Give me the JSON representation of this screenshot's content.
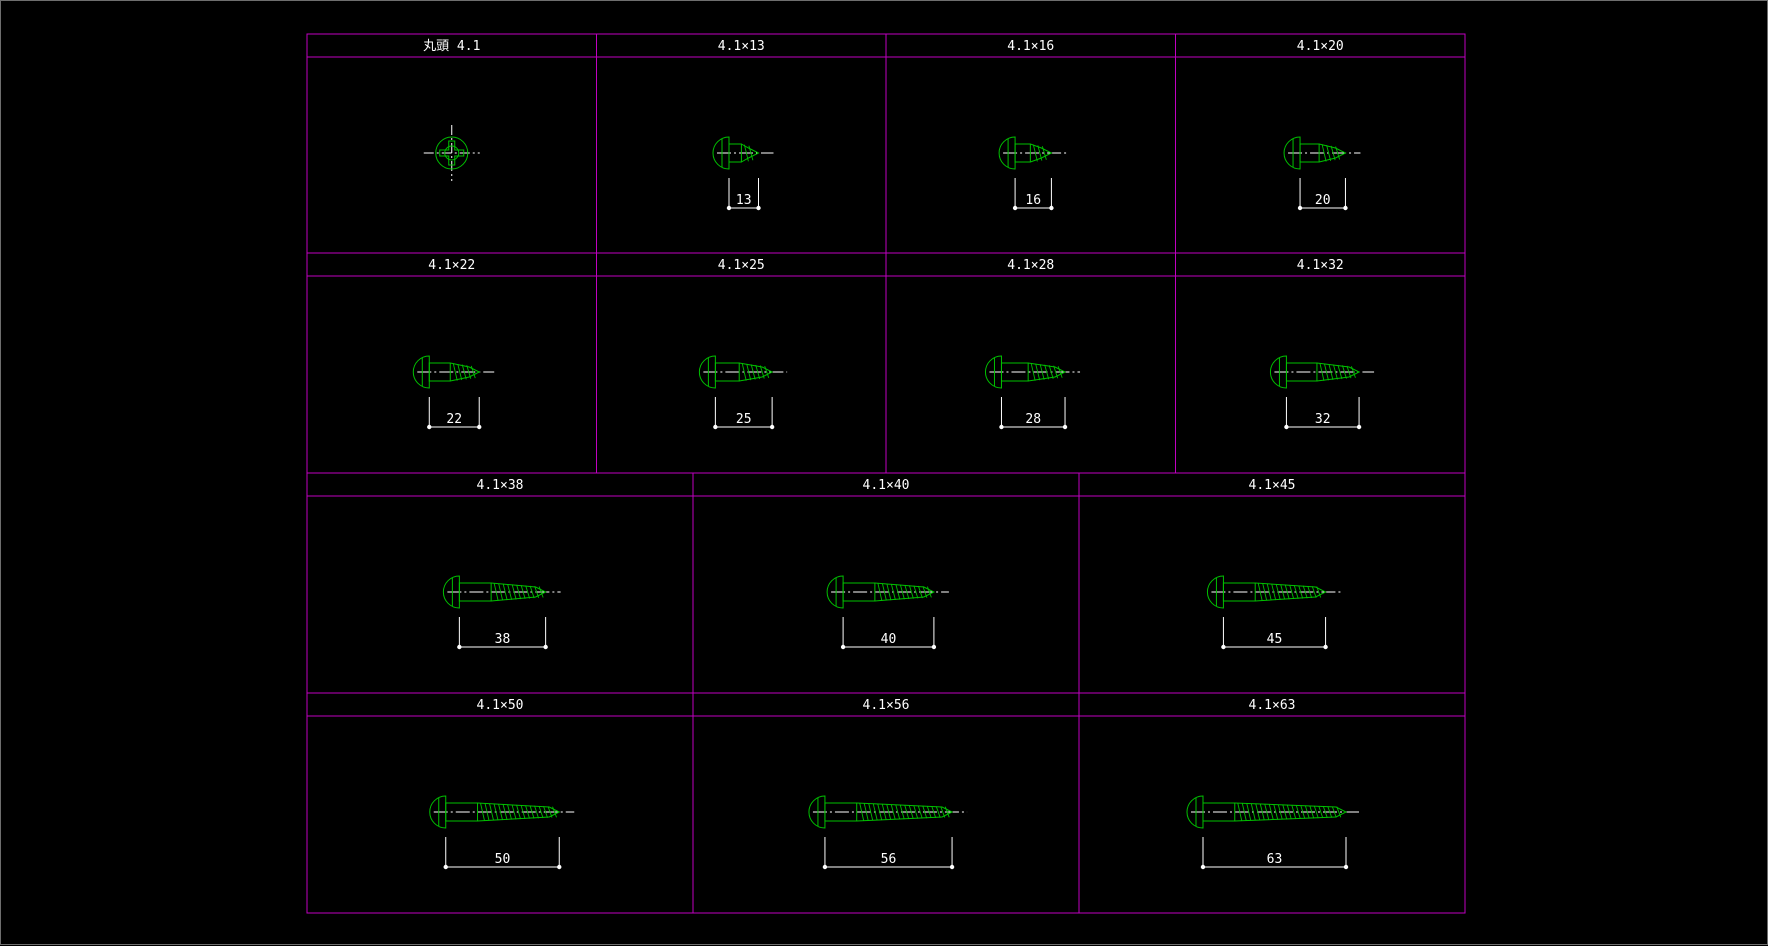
{
  "colors": {
    "background": "#000000",
    "frame": "#c000c0",
    "screw": "#00c000",
    "centerline": "#ffffff",
    "dimension": "#ffffff",
    "text": "#ffffff"
  },
  "rows": [
    {
      "cells": [
        {
          "title": "丸頭 4.1",
          "view": "top"
        },
        {
          "title": "4.1×13",
          "length": 13,
          "dim_label": "13"
        },
        {
          "title": "4.1×16",
          "length": 16,
          "dim_label": "16"
        },
        {
          "title": "4.1×20",
          "length": 20,
          "dim_label": "20"
        }
      ]
    },
    {
      "cells": [
        {
          "title": "4.1×22",
          "length": 22,
          "dim_label": "22"
        },
        {
          "title": "4.1×25",
          "length": 25,
          "dim_label": "25"
        },
        {
          "title": "4.1×28",
          "length": 28,
          "dim_label": "28"
        },
        {
          "title": "4.1×32",
          "length": 32,
          "dim_label": "32"
        }
      ]
    },
    {
      "cells": [
        {
          "title": "4.1×38",
          "length": 38,
          "dim_label": "38"
        },
        {
          "title": "4.1×40",
          "length": 40,
          "dim_label": "40"
        },
        {
          "title": "4.1×45",
          "length": 45,
          "dim_label": "45"
        }
      ]
    },
    {
      "cells": [
        {
          "title": "4.1×50",
          "length": 50,
          "dim_label": "50"
        },
        {
          "title": "4.1×56",
          "length": 56,
          "dim_label": "56"
        },
        {
          "title": "4.1×63",
          "length": 63,
          "dim_label": "63"
        }
      ]
    }
  ]
}
